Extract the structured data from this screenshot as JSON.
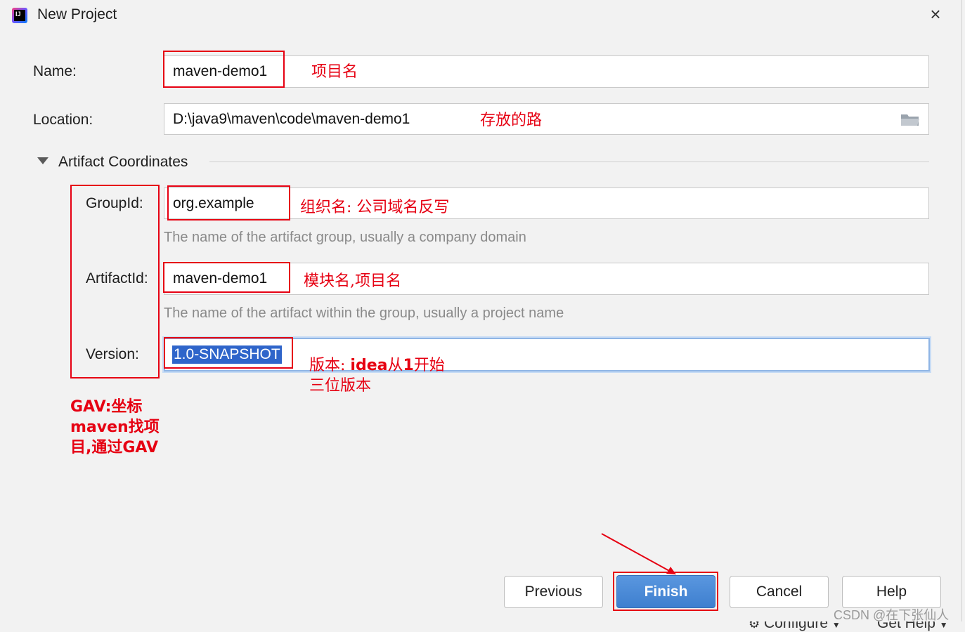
{
  "window": {
    "title": "New Project",
    "logo_text": "IJ"
  },
  "form": {
    "name_label": "Name:",
    "name_value": "maven-demo1",
    "location_label": "Location:",
    "location_value": "D:\\java9\\maven\\code\\maven-demo1",
    "section_title": "Artifact Coordinates",
    "groupid_label": "GroupId:",
    "groupid_value": "org.example",
    "groupid_hint": "The name of the artifact group, usually a company domain",
    "artifactid_label": "ArtifactId:",
    "artifactid_value": "maven-demo1",
    "artifactid_hint": "The name of the artifact within the group, usually a project name",
    "version_label": "Version:",
    "version_value": "1.0-SNAPSHOT"
  },
  "annotations": {
    "name_note": "项目名",
    "location_note": "存放的路",
    "groupid_note": "组织名: 公司域名反写",
    "artifactid_note": "模块名,项目名",
    "version_note_1a": "版本: ",
    "version_note_1b": "idea",
    "version_note_1c": "从",
    "version_note_1d": "1",
    "version_note_1e": "开始",
    "version_note_2": "三位版本",
    "gav_line1": "GAV:坐标",
    "gav_line2": "maven找项",
    "gav_line3": "目,通过GAV"
  },
  "buttons": {
    "previous": "Previous",
    "finish": "Finish",
    "cancel": "Cancel",
    "help": "Help"
  },
  "background": {
    "configure": "Configure",
    "get_help": "Get Help"
  },
  "watermark": "CSDN @在下张仙人",
  "colors": {
    "annotation": "#e60012",
    "accent": "#3e7fcf"
  }
}
